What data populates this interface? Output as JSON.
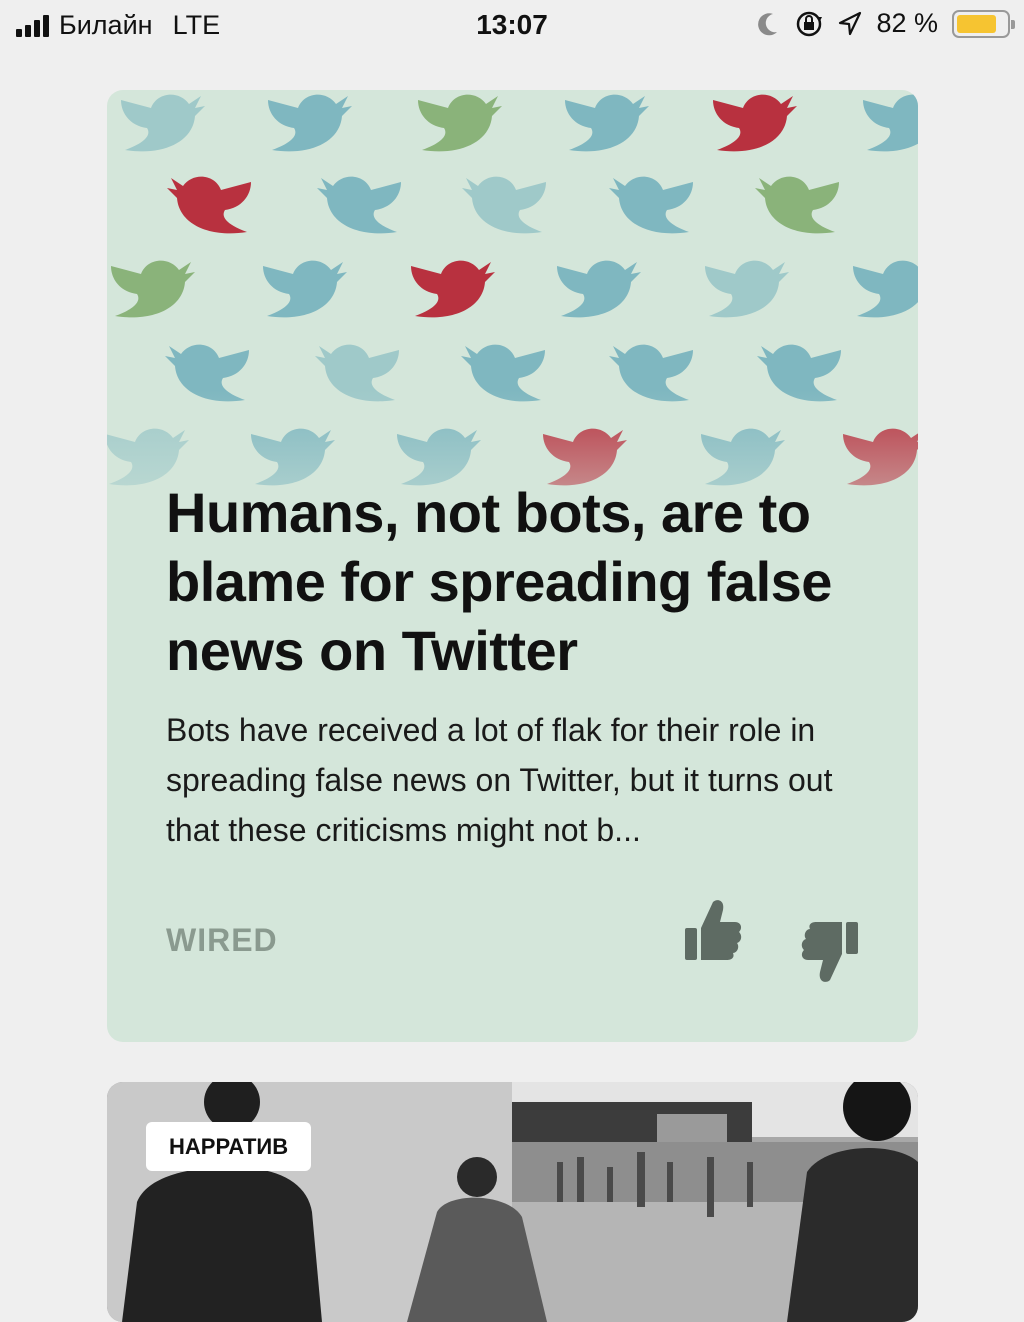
{
  "status_bar": {
    "carrier": "Билайн",
    "network": "LTE",
    "time": "13:07",
    "battery_percent_text": "82 %",
    "battery_level": 0.82,
    "icons": [
      "signal-icon",
      "moon-icon",
      "orientation-lock-icon",
      "location-arrow-icon",
      "battery-icon"
    ]
  },
  "article_card": {
    "headline": "Humans, not bots, are to blame for spreading false news on Twitter",
    "snippet": "Bots have received a lot of flak for their role in spreading false news on Twitter, but it turns out that these criticisms might not b...",
    "source": "WIRED",
    "image_icon": "twitter-birds-pattern",
    "colors": {
      "background": "#d4e6da",
      "bird_blue": "#7fb7c0",
      "bird_red": "#b8313f",
      "bird_green": "#8ab37a"
    }
  },
  "next_card": {
    "tag": "НАРРАТИВ",
    "image_icon": "black-and-white-photo"
  },
  "actions": {
    "like_icon": "thumbs-up-icon",
    "dislike_icon": "thumbs-down-icon"
  }
}
